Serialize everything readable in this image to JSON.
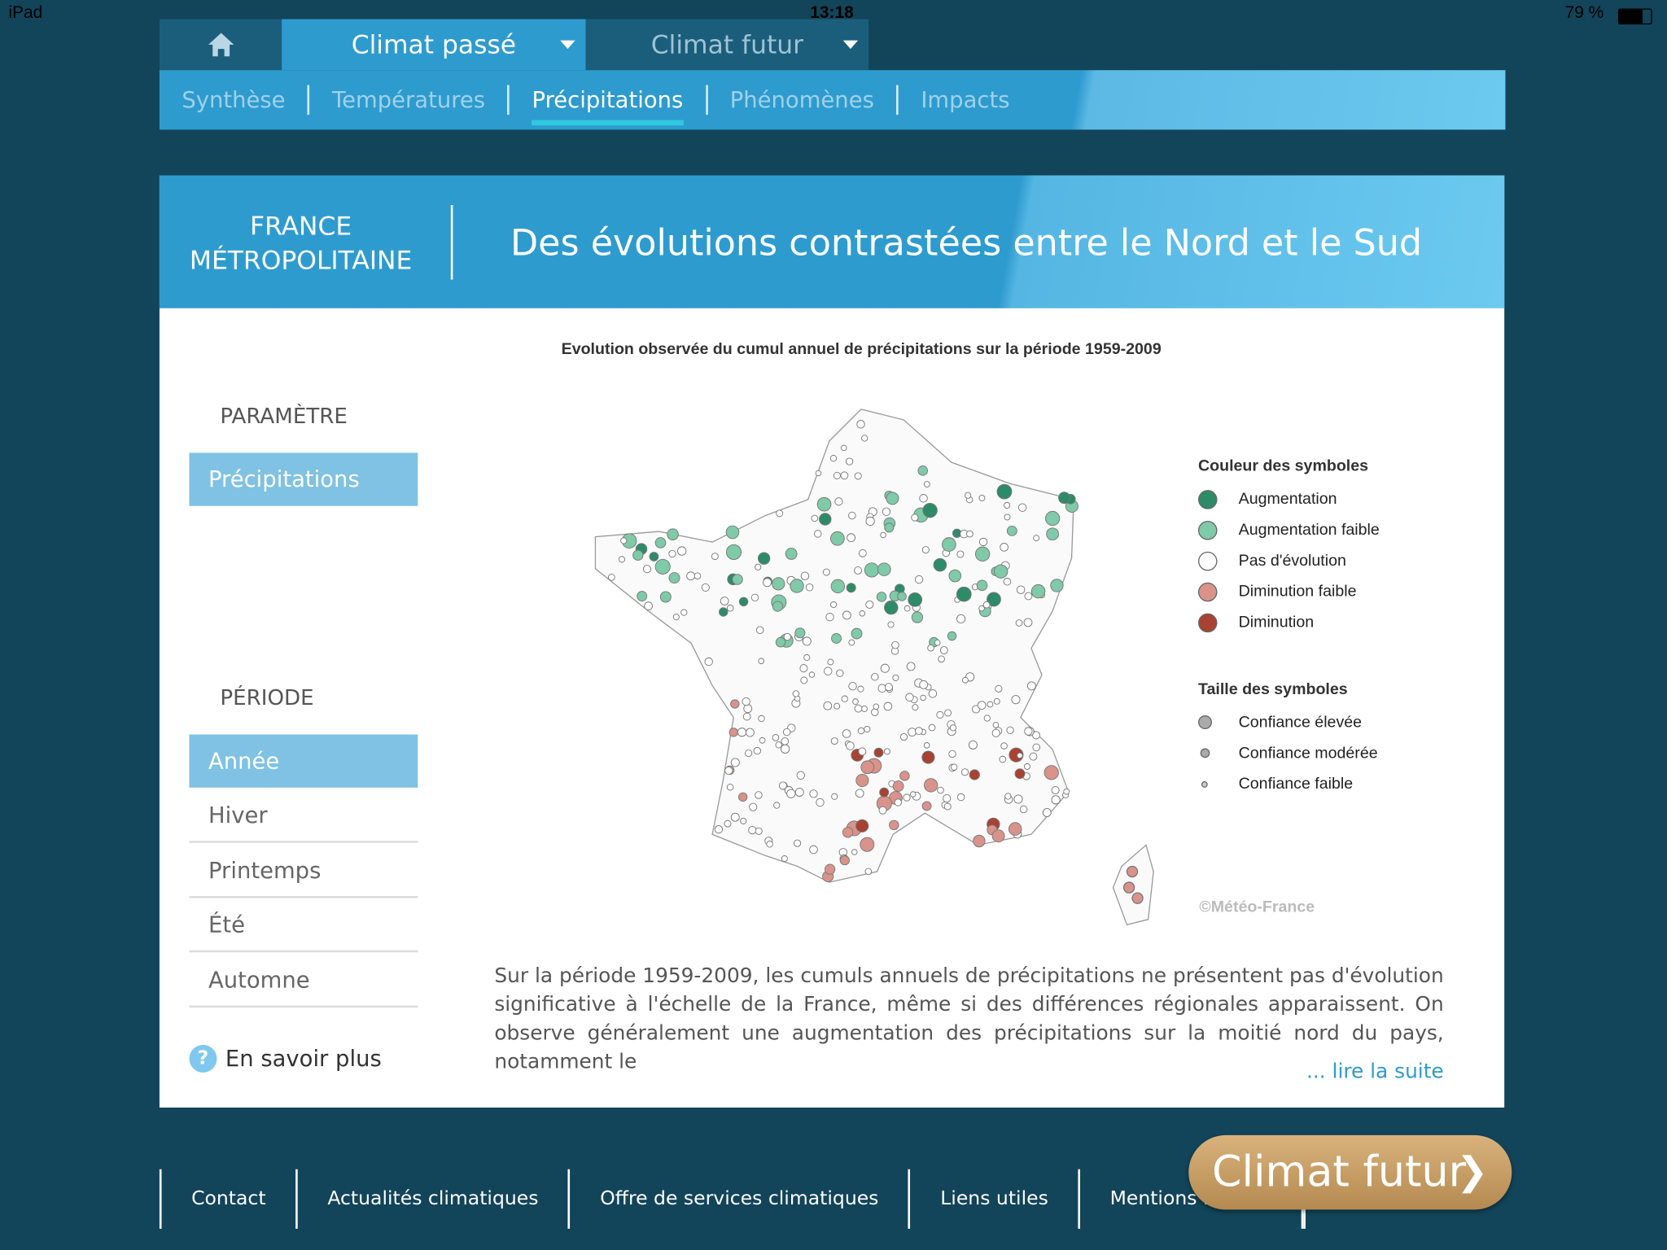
{
  "status_bar": {
    "device": "iPad",
    "time": "13:18",
    "battery": "79 %"
  },
  "top_nav": {
    "home_icon": "home-icon",
    "tabs": [
      {
        "label": "Climat passé",
        "active": true
      },
      {
        "label": "Climat futur",
        "active": false
      }
    ]
  },
  "sub_nav": [
    {
      "label": "Synthèse"
    },
    {
      "label": "Températures"
    },
    {
      "label": "Précipitations",
      "active": true
    },
    {
      "label": "Phénomènes"
    },
    {
      "label": "Impacts"
    }
  ],
  "banner": {
    "region": "FRANCE MÉTROPOLITAINE",
    "region_line1": "FRANCE",
    "region_line2": "MÉTROPOLITAINE",
    "title": "Des évolutions contrastées entre le Nord et le Sud"
  },
  "sidebar": {
    "parametre_heading": "PARAMÈTRE",
    "parametre_selected": "Précipitations",
    "periode_heading": "PÉRIODE",
    "periods": [
      {
        "label": "Année",
        "active": true
      },
      {
        "label": "Hiver"
      },
      {
        "label": "Printemps"
      },
      {
        "label": "Été"
      },
      {
        "label": "Automne"
      }
    ],
    "more": "En savoir plus"
  },
  "map": {
    "title": "Evolution observée du cumul annuel de précipitations sur la période 1959-2009",
    "legend_color_heading": "Couleur des symboles",
    "legend_colors": [
      {
        "label": "Augmentation",
        "color": "#2e8b6a"
      },
      {
        "label": "Augmentation faible",
        "color": "#7fcaa8"
      },
      {
        "label": "Pas d'évolution",
        "color": "#ffffff"
      },
      {
        "label": "Diminution faible",
        "color": "#d9938a"
      },
      {
        "label": "Diminution",
        "color": "#a84232"
      }
    ],
    "legend_size_heading": "Taille des symboles",
    "legend_sizes": [
      {
        "label": "Confiance élevée"
      },
      {
        "label": "Confiance modérée"
      },
      {
        "label": "Confiance faible"
      }
    ],
    "credit": "©Météo-France"
  },
  "description": {
    "text": "Sur la période 1959-2009, les cumuls annuels de précipitations ne présentent pas d'évolution significative à l'échelle de la France, même si des différences régionales apparaissent. On observe généralement une augmentation des précipitations sur la moitié nord du pays, notamment le",
    "read_more": "... lire la suite"
  },
  "footer": {
    "links": [
      "Contact",
      "Actualités climatiques",
      "Offre de services climatiques",
      "Liens utiles",
      "Mentions légales"
    ]
  },
  "cta": {
    "label": "Climat futur"
  }
}
